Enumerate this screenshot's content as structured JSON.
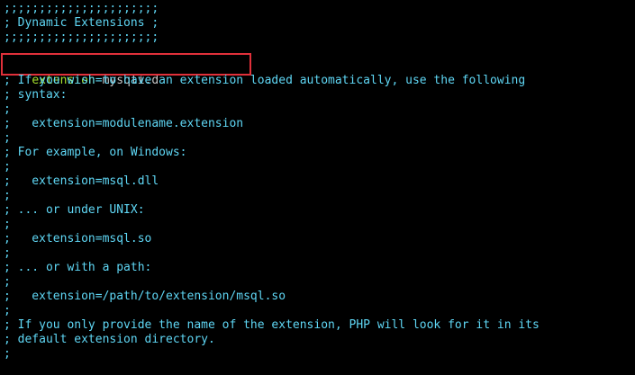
{
  "editor": {
    "lines_top": [
      ";;;;;;;;;;;;;;;;;;;;;;",
      "; Dynamic Extensions ;",
      ";;;;;;;;;;;;;;;;;;;;;;"
    ],
    "active_line": {
      "key": "extension",
      "operator": "=",
      "value": "mysqli.d"
    },
    "lines_body": [
      "; If you wish to have an extension loaded automatically, use the following",
      "; syntax:",
      ";",
      ";   extension=modulename.extension",
      ";",
      "; For example, on Windows:",
      ";",
      ";   extension=msql.dll",
      ";",
      "; ... or under UNIX:",
      ";",
      ";   extension=msql.so",
      ";",
      "; ... or with a path:",
      ";",
      ";   extension=/path/to/extension/msql.so",
      ";",
      "; If you only provide the name of the extension, PHP will look for it in its",
      "; default extension directory.",
      ";"
    ]
  },
  "colors": {
    "background": "#000000",
    "comment_text": "#5fd7f5",
    "directive_key": "#a6e22e",
    "directive_value": "#c8c8c8",
    "highlight_border": "#e0303a"
  }
}
